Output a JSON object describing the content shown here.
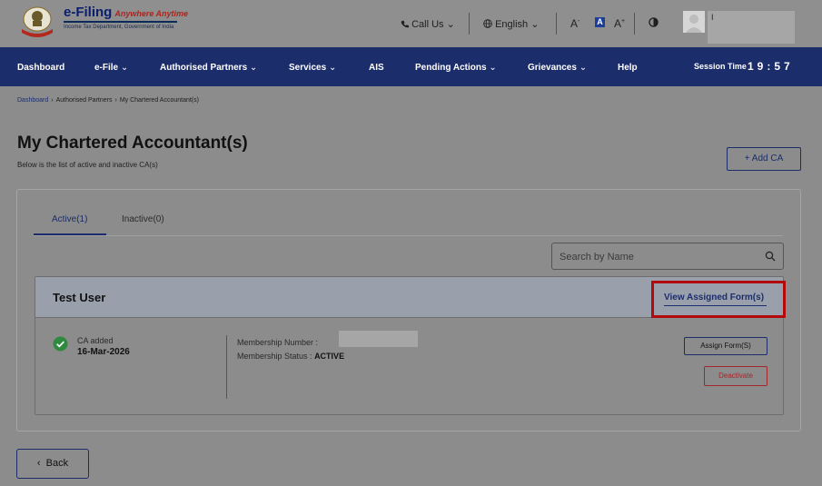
{
  "header": {
    "logo_title": "e-Filing",
    "logo_tagline": "Anywhere Anytime",
    "logo_subtitle": "Income Tax Department, Government of India",
    "call_us": "Call Us",
    "language": "English",
    "font_decrease": "A",
    "font_normal": "A",
    "font_increase": "A",
    "user_initial": "I"
  },
  "nav": {
    "items": [
      {
        "label": "Dashboard"
      },
      {
        "label": "e-File"
      },
      {
        "label": "Authorised Partners"
      },
      {
        "label": "Services"
      },
      {
        "label": "AIS"
      },
      {
        "label": "Pending Actions"
      },
      {
        "label": "Grievances"
      },
      {
        "label": "Help"
      }
    ],
    "session_label": "Session Time",
    "session_time": "19:57"
  },
  "breadcrumb": [
    "Dashboard",
    "Authorised Partners",
    "My Chartered Accountant(s)"
  ],
  "page": {
    "title": "My Chartered Accountant(s)",
    "subtitle": "Below is the list of active and inactive CA(s)",
    "add_button": "+ Add CA"
  },
  "tabs": [
    {
      "label": "Active(1)",
      "active": true
    },
    {
      "label": "Inactive(0)",
      "active": false
    }
  ],
  "search": {
    "placeholder": "Search by Name",
    "value": ""
  },
  "ca_entry": {
    "name": "Test User",
    "view_link": "View Assigned Form(s)",
    "status_label": "CA added",
    "date": "16-Mar-2026",
    "membership_number_label": "Membership Number :",
    "membership_status_label": "Membership Status :",
    "membership_status_value": "ACTIVE",
    "assign_button": "Assign Form(S)",
    "deactivate_button": "Deactivate"
  },
  "back_button": "Back",
  "colors": {
    "nav_bg": "#1b2d6b",
    "accent": "#1b2d6b",
    "highlight": "#b30b0b",
    "success": "#2e8a3e",
    "danger": "#a3262a"
  },
  "icons": {
    "call": "phone-icon",
    "language": "globe-icon",
    "contrast": "contrast-icon",
    "search": "search-icon",
    "status": "check-circle-icon",
    "back": "chevron-left-icon"
  }
}
